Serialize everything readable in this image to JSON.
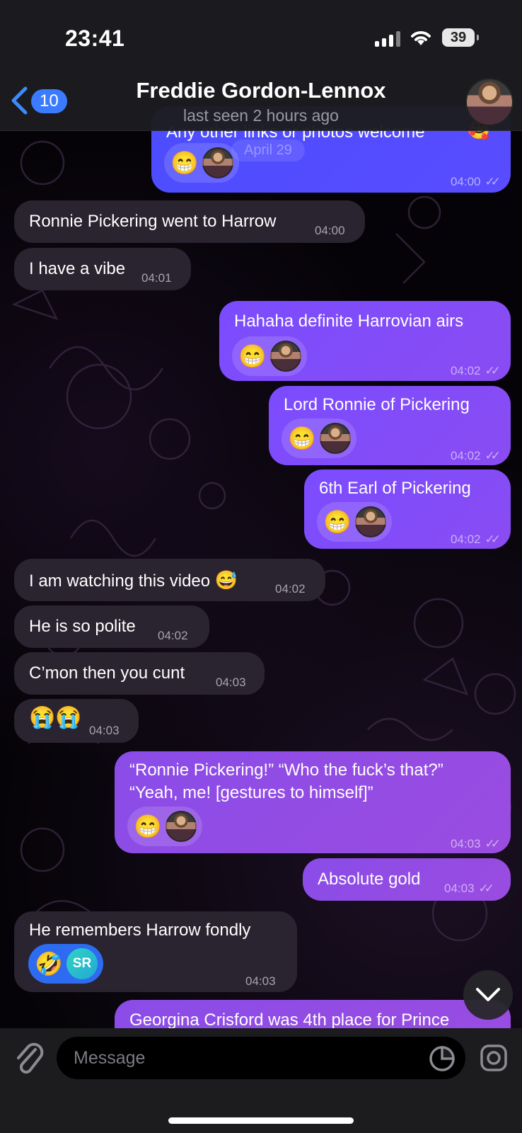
{
  "status_bar": {
    "time": "23:41",
    "battery": "39"
  },
  "header": {
    "back_count": "10",
    "name": "Freddie Gordon-Lennox",
    "last_seen": "last seen 2 hours ago"
  },
  "ghost_date": "April 29",
  "messages": [
    {
      "text": "Any other links or photos welcome",
      "time": "04:00",
      "reaction": "😁"
    },
    {
      "text": "Ronnie Pickering went to Harrow",
      "time": "04:00"
    },
    {
      "text": "I have a vibe",
      "time": "04:01"
    },
    {
      "text": "Hahaha definite Harrovian airs",
      "time": "04:02",
      "reaction": "😁"
    },
    {
      "text": "Lord Ronnie of Pickering",
      "time": "04:02",
      "reaction": "😁"
    },
    {
      "text": "6th Earl of Pickering",
      "time": "04:02",
      "reaction": "😁"
    },
    {
      "text": "I am watching this video",
      "emoji": "😅",
      "time": "04:02"
    },
    {
      "text": "He is so polite",
      "time": "04:02"
    },
    {
      "text": "C’mon then you cunt",
      "time": "04:03"
    },
    {
      "text": "😭😭",
      "time": "04:03"
    },
    {
      "line1": "“Ronnie Pickering!” “Who the fuck’s that?”",
      "line2": "“Yeah, me! [gestures to himself]”",
      "time": "04:03",
      "reaction": "😁"
    },
    {
      "text": "Absolute gold",
      "time": "04:03"
    },
    {
      "text": "He remembers Harrow fondly",
      "time": "04:03",
      "reaction": "🤣",
      "reactor": "SR"
    },
    {
      "text": "Georgina Crisford was 4th place for Prince"
    }
  ],
  "composer": {
    "placeholder": "Message"
  }
}
